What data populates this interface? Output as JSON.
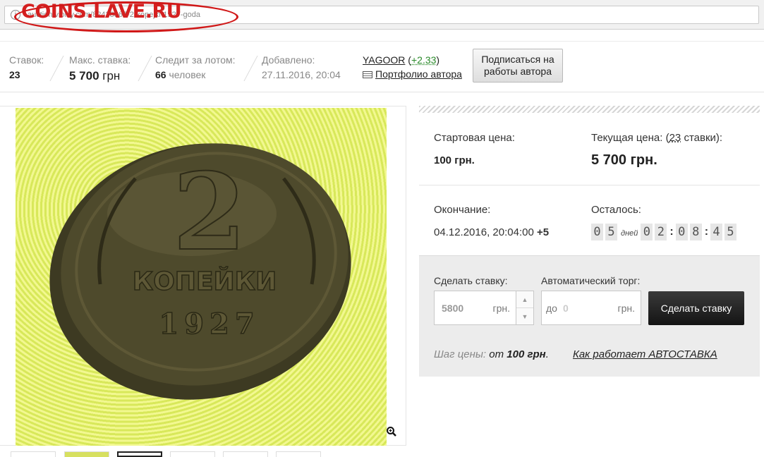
{
  "address_bar": {
    "url": "auction.violity.com/82438867-2-kopejki-1927-goda",
    "watermark": "COINS.LAVE.RU"
  },
  "stats": {
    "bids_label": "Ставок:",
    "bids_value": "23",
    "max_bid_label": "Макс. ставка:",
    "max_bid_value": "5 700",
    "max_bid_currency": "грн",
    "watchers_label": "Следит за лотом:",
    "watchers_value": "66",
    "watchers_unit": "человек",
    "added_label": "Добавлено:",
    "added_value": "27.11.2016, 20:04",
    "author_name": "YAGOOR",
    "author_rating": "+2.33",
    "portfolio_link": "Портфолио автора",
    "subscribe_line1": "Подписаться на",
    "subscribe_line2": "работы автора"
  },
  "photo": {
    "coin_text": "КОПЕЙКИ",
    "coin_year": "1927",
    "coin_denomination": "2"
  },
  "pricing": {
    "start_label": "Стартовая цена:",
    "start_value": "100 грн.",
    "current_label_prefix": "Текущая цена: (",
    "current_bids": "23",
    "current_label_suffix": " ставки):",
    "current_value": "5 700 грн.",
    "end_label": "Окончание:",
    "end_value": "04.12.2016, 20:04:00",
    "end_tz": "+5",
    "remaining_label": "Осталось:",
    "days_word": "дней",
    "timer_digits": [
      "0",
      "5",
      "0",
      "2",
      "0",
      "8",
      "4",
      "5"
    ]
  },
  "bid_form": {
    "bid_label": "Сделать ставку:",
    "bid_value": "5800",
    "bid_currency": "грн.",
    "auto_label": "Автоматический торг:",
    "auto_prefix": "до",
    "auto_value": "0",
    "auto_currency": "грн.",
    "submit_label": "Сделать ставку",
    "step_label": "Шаг цены:",
    "step_from": "от",
    "step_value": "100 грн",
    "howto_link": "Как работает АВТОСТАВКА"
  },
  "colors": {
    "watermark": "#d42020",
    "rating": "#2a8a2a",
    "button_dark": "#1e1e1e"
  }
}
